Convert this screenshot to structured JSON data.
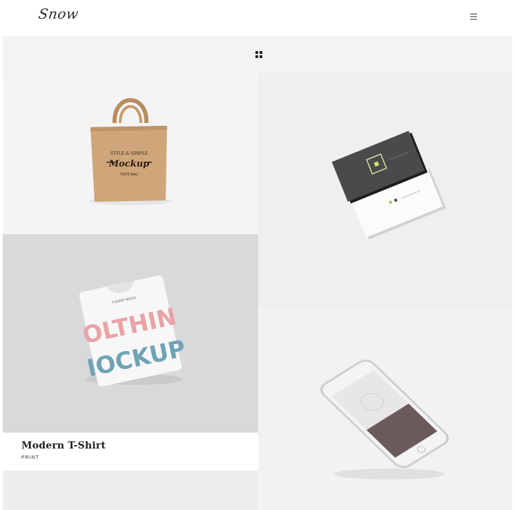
{
  "header": {
    "logo_text": "Snow",
    "menu_icon": "hamburger-icon"
  },
  "filter": {
    "icon": "grid-icon"
  },
  "portfolio": {
    "items": [
      {
        "image": "tote-bag-mockup"
      },
      {
        "image": "business-cards-mockup"
      },
      {
        "image": "tshirt-mockup",
        "title": "Modern T-Shirt",
        "category": "PRINT"
      },
      {
        "image": "phone-mockup"
      }
    ]
  },
  "colors": {
    "background": "#f3f3f4",
    "header": "#ffffff",
    "text": "#1e1e1e"
  }
}
